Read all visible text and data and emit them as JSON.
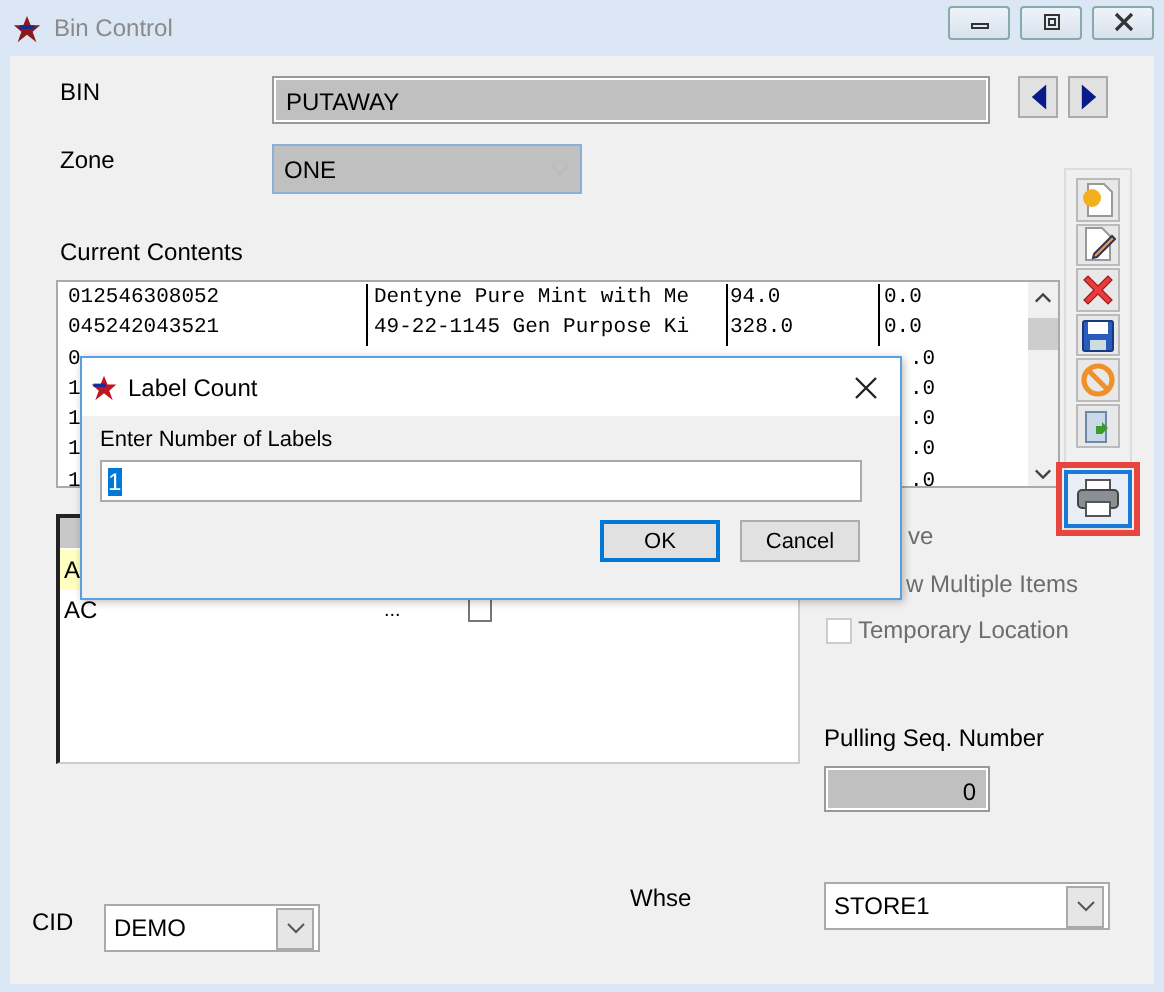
{
  "window": {
    "title": "Bin Control"
  },
  "bin": {
    "label": "BIN",
    "value": "PUTAWAY"
  },
  "zone": {
    "label": "Zone",
    "value": "ONE",
    "disabled": true
  },
  "contents": {
    "label": "Current Contents",
    "rows": [
      {
        "item": "012546308052",
        "description": "Dentyne Pure Mint with Me",
        "qty": "94.0",
        "column_4": "0.0"
      },
      {
        "item": "045242043521",
        "description": "49-22-1145 Gen Purpose Ki",
        "qty": "328.0",
        "column_4": "0.0"
      },
      {
        "item": "0",
        "column_4": ".0"
      },
      {
        "item": "1",
        "column_4": ".0"
      },
      {
        "item": "1",
        "column_4": ".0"
      },
      {
        "item": "1",
        "column_4": ".0"
      },
      {
        "item": "1",
        "column_4": ".0"
      }
    ]
  },
  "toolbar": [
    {
      "kind": "new",
      "highlighted": false
    },
    {
      "kind": "edit",
      "highlighted": false
    },
    {
      "kind": "delete",
      "highlighted": false
    },
    {
      "kind": "save",
      "highlighted": false
    },
    {
      "kind": "cancel",
      "highlighted": false
    },
    {
      "kind": "copy",
      "highlighted": false
    },
    {
      "kind": "print",
      "highlighted": true
    }
  ],
  "detail_grid": {
    "rows": [
      {
        "column_1": "A",
        "selected": true
      },
      {
        "column_1": "AC",
        "column_2": "...",
        "checked": false,
        "selected": false
      }
    ]
  },
  "options": [
    {
      "kind": "text",
      "label": "ve"
    },
    {
      "kind": "text",
      "label": "w Multiple Items"
    },
    {
      "kind": "checkbox",
      "label": "Temporary Location",
      "checked": false
    }
  ],
  "pulling_seq": {
    "label": "Pulling Seq. Number",
    "value": "0"
  },
  "cid": {
    "label": "CID",
    "value": "DEMO"
  },
  "whse": {
    "label": "Whse",
    "value": "STORE1"
  },
  "dialog": {
    "title": "Label Count",
    "prompt": "Enter Number of Labels",
    "value": "1",
    "buttons": [
      {
        "label": "OK",
        "focused": true
      },
      {
        "label": "Cancel",
        "focused": false
      }
    ]
  }
}
